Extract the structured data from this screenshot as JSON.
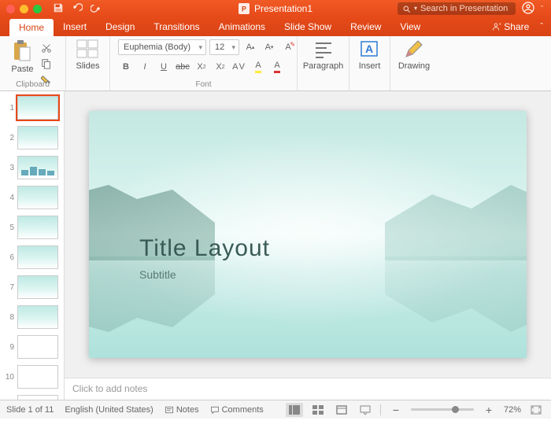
{
  "titlebar": {
    "filename": "Presentation1",
    "search_placeholder": "Search in Presentation"
  },
  "tabs": [
    "Home",
    "Insert",
    "Design",
    "Transitions",
    "Animations",
    "Slide Show",
    "Review",
    "View"
  ],
  "active_tab": "Home",
  "share_label": "Share",
  "ribbon": {
    "paste": "Paste",
    "clipboard_label": "Clipboard",
    "slides": "Slides",
    "font_name": "Euphemia (Body)",
    "font_size": "12",
    "font_label": "Font",
    "paragraph": "Paragraph",
    "insert": "Insert",
    "drawing": "Drawing"
  },
  "thumbnails": {
    "count": 11,
    "selected": 1
  },
  "slide": {
    "title": "Title  Layout",
    "subtitle": "Subtitle"
  },
  "notes_placeholder": "Click to add notes",
  "status": {
    "slide_indicator": "Slide 1 of 11",
    "language": "English (United States)",
    "notes_btn": "Notes",
    "comments_btn": "Comments",
    "zoom_pct": "72%"
  }
}
